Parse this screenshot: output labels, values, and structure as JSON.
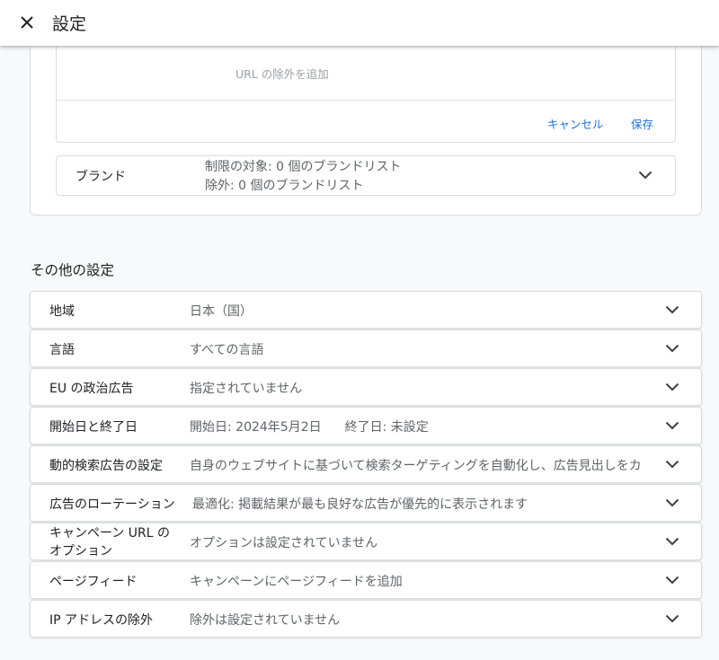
{
  "header": {
    "title": "設定"
  },
  "url_exclusion": {
    "add_text": "URL の除外を追加",
    "cancel_label": "キャンセル",
    "save_label": "保存"
  },
  "brand": {
    "label": "ブランド",
    "restrict_text": "制限の対象: 0 個のブランドリスト",
    "exclude_text": "除外: 0 個のブランドリスト"
  },
  "other_settings": {
    "heading": "その他の設定",
    "rows": [
      {
        "label": "地域",
        "value": "日本（国）"
      },
      {
        "label": "言語",
        "value": "すべての言語"
      },
      {
        "label": "EU の政治広告",
        "value": "指定されていません"
      },
      {
        "label": "開始日と終了日",
        "value": "開始日: 2024年5月2日",
        "value2": "終了日: 未設定"
      },
      {
        "label": "動的検索広告の設定",
        "value": "自身のウェブサイトに基づいて検索ターゲティングを自動化し、広告見出しをカ"
      },
      {
        "label": "広告のローテーション",
        "value": "最適化: 掲載結果が最も良好な広告が優先的に表示されます"
      },
      {
        "label": "キャンペーン URL の オプション",
        "value": "オプションは設定されていません"
      },
      {
        "label": "ページフィード",
        "value": "キャンペーンにページフィードを追加"
      },
      {
        "label": "IP アドレスの除外",
        "value": "除外は設定されていません"
      }
    ]
  },
  "colors": {
    "link": "#1a73e8",
    "text_primary": "#202124",
    "text_secondary": "#5f6368",
    "border": "#dadce0"
  },
  "icons": {
    "close": "close-icon",
    "expand": "chevron-down-icon"
  }
}
